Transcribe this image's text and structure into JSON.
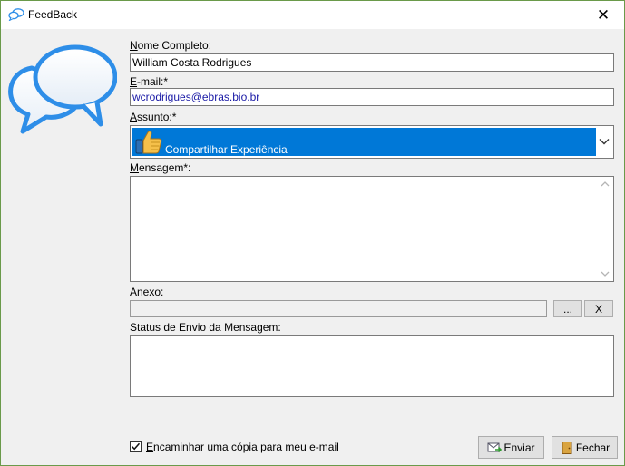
{
  "window": {
    "title": "FeedBack",
    "close_glyph": "✕"
  },
  "form": {
    "name": {
      "label_accel": "N",
      "label_rest": "ome Completo:",
      "value": "William Costa Rodrigues"
    },
    "email": {
      "label_accel": "E",
      "label_rest": "-mail:*",
      "value": "wcrodrigues@ebras.bio.br"
    },
    "subject": {
      "label_accel": "A",
      "label_rest": "ssunto:*",
      "selected": "Compartilhar Experiência",
      "icon": "thumbs-up-icon"
    },
    "message": {
      "label_accel": "M",
      "label_rest": "ensagem*:",
      "value": ""
    },
    "attachment": {
      "label": "Anexo:",
      "value": "",
      "browse_label": "...",
      "clear_label": "X"
    },
    "status": {
      "label": "Status de Envio da Mensagem:",
      "value": ""
    },
    "copy": {
      "checked": true,
      "label_accel": "E",
      "label_rest": "ncaminhar uma cópia para meu e-mail"
    }
  },
  "buttons": {
    "send_label": "Enviar",
    "close_label": "Fechar"
  },
  "colors": {
    "selection": "#0078d7",
    "bubble_blue": "#2e8ee8",
    "border": "#7a7a7a",
    "window_border": "#6a9a4a"
  }
}
